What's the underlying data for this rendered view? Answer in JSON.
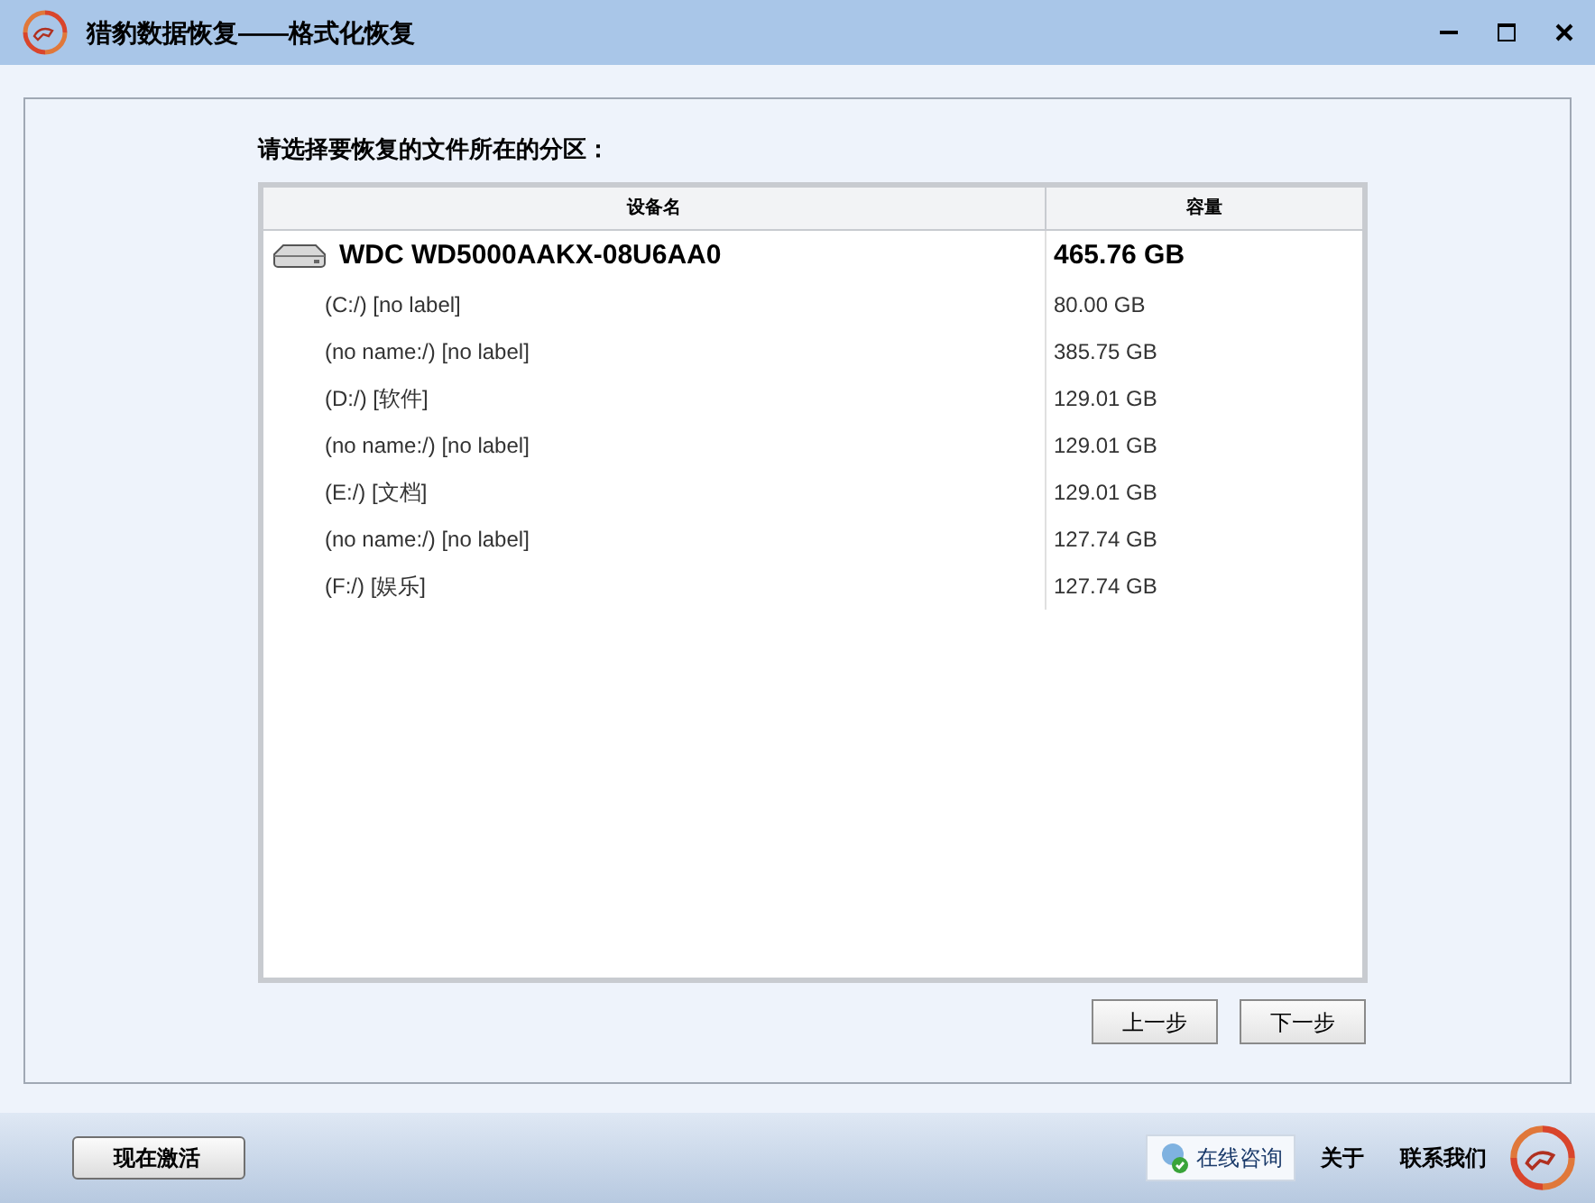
{
  "window": {
    "title": "猎豹数据恢复——格式化恢复"
  },
  "prompt": "请选择要恢复的文件所在的分区：",
  "table": {
    "columns": [
      "设备名",
      "容量"
    ],
    "rows": [
      {
        "name": "WDC WD5000AAKX-08U6AA0",
        "size": "465.76 GB",
        "children": [
          {
            "name": "(C:/) [no label]",
            "size": "80.00 GB"
          },
          {
            "name": "(no name:/) [no label]",
            "size": "385.75 GB"
          },
          {
            "name": "(D:/) [软件]",
            "size": "129.01 GB"
          },
          {
            "name": "(no name:/) [no label]",
            "size": "129.01 GB"
          },
          {
            "name": "(E:/) [文档]",
            "size": "129.01 GB"
          },
          {
            "name": "(no name:/) [no label]",
            "size": "127.74 GB"
          },
          {
            "name": "(F:/) [娱乐]",
            "size": "127.74 GB"
          }
        ]
      }
    ]
  },
  "nav_buttons": [
    "上一步",
    "下一步"
  ],
  "footer": {
    "activate": "现在激活",
    "consult": "在线咨询",
    "about": "关于",
    "contact": "联系我们"
  }
}
